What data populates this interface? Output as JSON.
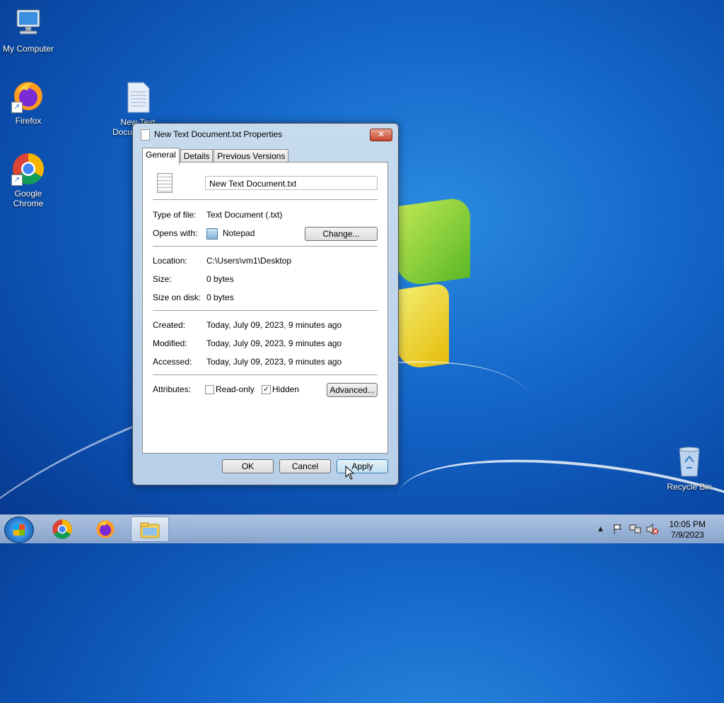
{
  "desktop": {
    "icons": {
      "my_computer": "My Computer",
      "firefox": "Firefox",
      "chrome_line1": "Google",
      "chrome_line2": "Chrome",
      "textdoc_line1": "New Text",
      "textdoc_line2": "Docu",
      "recycle_bin": "Recycle Bin"
    }
  },
  "dialog": {
    "title": "New Text Document.txt Properties",
    "close_glyph": "✕",
    "tabs": [
      "General",
      "Details",
      "Previous Versions"
    ],
    "filename": "New Text Document.txt",
    "type_label": "Type of file:",
    "type_value": "Text Document (.txt)",
    "opens_label": "Opens with:",
    "opens_value": "Notepad",
    "change_label": "Change...",
    "location_label": "Location:",
    "location_value": "C:\\Users\\vm1\\Desktop",
    "size_label": "Size:",
    "size_value": "0 bytes",
    "size_disk_label": "Size on disk:",
    "size_disk_value": "0 bytes",
    "created_label": "Created:",
    "created_value": "Today, July 09, 2023, 9 minutes ago",
    "modified_label": "Modified:",
    "modified_value": "Today, July 09, 2023, 9 minutes ago",
    "accessed_label": "Accessed:",
    "accessed_value": "Today, July 09, 2023, 9 minutes ago",
    "attributes_label": "Attributes:",
    "readonly_label": "Read-only",
    "readonly_checked": false,
    "hidden_label": "Hidden",
    "hidden_checked": true,
    "hidden_mark": "✓",
    "advanced_label": "Advanced...",
    "ok_label": "OK",
    "cancel_label": "Cancel",
    "apply_label": "Apply"
  },
  "taskbar": {
    "time": "10:05 PM",
    "date": "7/9/2023",
    "tray_arrow": "▲"
  },
  "colors": {
    "desktop_blue": "#1466c9",
    "dialog_frame": "#b8cfe9",
    "close_red": "#c7442b"
  }
}
